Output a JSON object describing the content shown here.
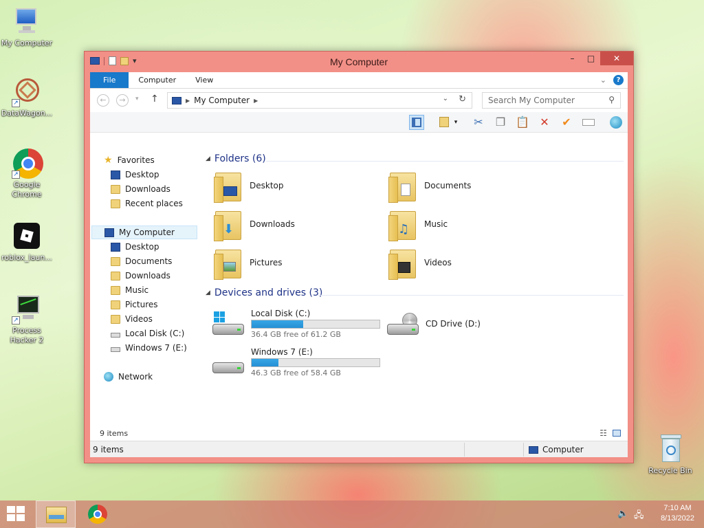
{
  "desktop": {
    "icons": [
      {
        "label": "My Computer"
      },
      {
        "label": "DataWagon..."
      },
      {
        "label": "Google Chrome"
      },
      {
        "label": "roblox_laun..."
      },
      {
        "label": "Process Hacker 2"
      },
      {
        "label": "Recycle Bin"
      }
    ]
  },
  "window": {
    "title": "My Computer",
    "controls": {
      "minimize": "–",
      "maximize": "□",
      "close": "✕"
    },
    "ribbon_tabs": [
      {
        "label": "File"
      },
      {
        "label": "Computer"
      },
      {
        "label": "View"
      }
    ],
    "address": {
      "root": "My Computer"
    },
    "search": {
      "placeholder": "Search My Computer"
    },
    "nav": {
      "favorites": "Favorites",
      "favorite_items": [
        "Desktop",
        "Downloads",
        "Recent places"
      ],
      "computer": "My Computer",
      "computer_items": [
        "Desktop",
        "Documents",
        "Downloads",
        "Music",
        "Pictures",
        "Videos",
        "Local Disk (C:)",
        "Windows 7 (E:)"
      ],
      "network": "Network"
    },
    "folders_header": "Folders (6)",
    "folders": [
      "Desktop",
      "Documents",
      "Downloads",
      "Music",
      "Pictures",
      "Videos"
    ],
    "drives_header": "Devices and drives (3)",
    "drives": [
      {
        "name": "Local Disk (C:)",
        "free": "36.4 GB free of 61.2 GB",
        "used_fraction": 0.405
      },
      {
        "name": "Windows 7 (E:)",
        "free": "46.3 GB free of 58.4 GB",
        "used_fraction": 0.207
      }
    ],
    "cd_drive": "CD Drive (D:)",
    "items_count": "9 items",
    "status": {
      "left": "9 items",
      "right": "Computer"
    }
  },
  "taskbar": {
    "time": "7:10 AM",
    "date": "8/13/2022"
  },
  "colors": {
    "accent": "#1979ca",
    "titlebar": "#f29087",
    "close": "#c9504a",
    "drive_bar": "#2690d5"
  }
}
